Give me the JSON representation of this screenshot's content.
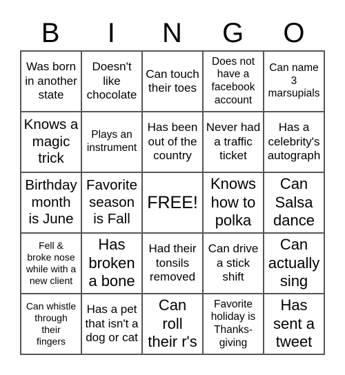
{
  "header": [
    "B",
    "I",
    "N",
    "G",
    "O"
  ],
  "cells": [
    "Was born\nin another\nstate",
    "Doesn't\nlike\nchocolate",
    "Can touch\ntheir toes",
    "Does not\nhave a\nfacebook\naccount",
    "Can name\n3\nmarsupials",
    "Knows a\nmagic\ntrick",
    "Plays an\ninstrument",
    "Has been\nout of the\ncountry",
    "Never had\na traffic\nticket",
    "Has a\ncelebrity's\nautograph",
    "Birthday\nmonth\nis June",
    "Favorite\nseason\nis Fall",
    "FREE!",
    "Knows\nhow to\npolka",
    "Can\nSalsa\ndance",
    "Fell &\nbroke nose\nwhile with a\nnew client",
    "Has\nbroken\na bone",
    "Had their\ntonsils\nremoved",
    "Can drive\na stick\nshift",
    "Can\nactually\nsing",
    "Can whistle\nthrough\ntheir\nfingers",
    "Has a pet\nthat isn't a\ndog or cat",
    "Can\nroll\ntheir r's",
    "Favorite\nholiday is\nThanks-\ngiving",
    "Has\nsent a\ntweet"
  ]
}
